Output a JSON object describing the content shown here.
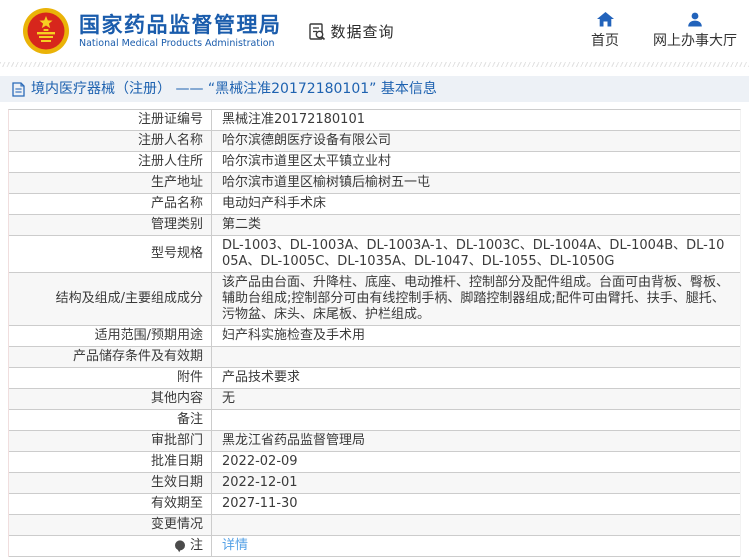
{
  "header": {
    "org_name_cn": "国家药品监督管理局",
    "org_name_en": "National Medical Products Administration",
    "nav_data_query": "数据查询",
    "nav_home": "首页",
    "nav_service_hall": "网上办事大厅"
  },
  "title_bar": {
    "title": "境内医疗器械（注册） —— “黑械注准20172180101” 基本信息"
  },
  "table": {
    "rows": [
      {
        "label": "注册证编号",
        "value": "黑械注准20172180101"
      },
      {
        "label": "注册人名称",
        "value": "哈尔滨德朗医疗设备有限公司"
      },
      {
        "label": "注册人住所",
        "value": "哈尔滨市道里区太平镇立业村"
      },
      {
        "label": "生产地址",
        "value": "哈尔滨市道里区榆树镇后榆树五一屯"
      },
      {
        "label": "产品名称",
        "value": "电动妇产科手术床"
      },
      {
        "label": "管理类别",
        "value": "第二类"
      },
      {
        "label": "型号规格",
        "value": "DL-1003、DL-1003A、DL-1003A-1、DL-1003C、DL-1004A、DL-1004B、DL-1005A、DL-1005C、DL-1035A、DL-1047、DL-1055、DL-1050G"
      },
      {
        "label": "结构及组成/主要组成成分",
        "value": "该产品由台面、升降柱、底座、电动推杆、控制部分及配件组成。台面可由背板、臀板、辅助台组成;控制部分可由有线控制手柄、脚踏控制器组成;配件可由臂托、扶手、腿托、污物盆、床头、床尾板、护栏组成。"
      },
      {
        "label": "适用范围/预期用途",
        "value": "妇产科实施检查及手术用"
      },
      {
        "label": "产品储存条件及有效期",
        "value": ""
      },
      {
        "label": "附件",
        "value": "产品技术要求"
      },
      {
        "label": "其他内容",
        "value": "无"
      },
      {
        "label": "备注",
        "value": ""
      },
      {
        "label": "审批部门",
        "value": "黑龙江省药品监督管理局"
      },
      {
        "label": "批准日期",
        "value": "2022-02-09"
      },
      {
        "label": "生效日期",
        "value": "2022-12-01"
      },
      {
        "label": "有效期至",
        "value": "2027-11-30"
      },
      {
        "label": "变更情况",
        "value": ""
      },
      {
        "label": "注",
        "value": "详情",
        "value_is_link": true,
        "label_icon": "note-icon"
      }
    ]
  },
  "colors": {
    "brand_blue": "#1a5cac",
    "icon_blue": "#2263bb",
    "link_blue": "#55a1e6",
    "title_bar_bg": "#edf1f6",
    "title_bar_text": "#1e62b0",
    "stripe_gray": "#f7f7f7",
    "border_gray": "#cccccc",
    "emblem_red": "#d7261c",
    "emblem_gold": "#eab308"
  }
}
